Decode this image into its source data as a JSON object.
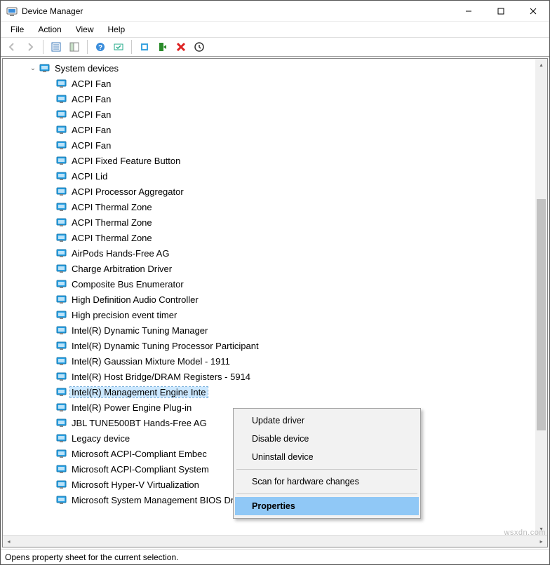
{
  "window": {
    "title": "Device Manager"
  },
  "menus": {
    "file": "File",
    "action": "Action",
    "view": "View",
    "help": "Help"
  },
  "tree": {
    "root": {
      "label": "System devices",
      "expanded": true
    },
    "items": [
      {
        "label": "ACPI Fan"
      },
      {
        "label": "ACPI Fan"
      },
      {
        "label": "ACPI Fan"
      },
      {
        "label": "ACPI Fan"
      },
      {
        "label": "ACPI Fan"
      },
      {
        "label": "ACPI Fixed Feature Button"
      },
      {
        "label": "ACPI Lid"
      },
      {
        "label": "ACPI Processor Aggregator"
      },
      {
        "label": "ACPI Thermal Zone"
      },
      {
        "label": "ACPI Thermal Zone"
      },
      {
        "label": "ACPI Thermal Zone"
      },
      {
        "label": "AirPods Hands-Free AG"
      },
      {
        "label": "Charge Arbitration Driver"
      },
      {
        "label": "Composite Bus Enumerator"
      },
      {
        "label": "High Definition Audio Controller"
      },
      {
        "label": "High precision event timer"
      },
      {
        "label": "Intel(R) Dynamic Tuning Manager"
      },
      {
        "label": "Intel(R) Dynamic Tuning Processor Participant"
      },
      {
        "label": "Intel(R) Gaussian Mixture Model - 1911"
      },
      {
        "label": "Intel(R) Host Bridge/DRAM Registers - 5914"
      },
      {
        "label": "Intel(R) Management Engine Interface",
        "selected": true,
        "truncated": "Intel(R) Management Engine Inte"
      },
      {
        "label": "Intel(R) Power Engine Plug-in"
      },
      {
        "label": "JBL TUNE500BT Hands-Free AG"
      },
      {
        "label": "Legacy device"
      },
      {
        "label": "Microsoft ACPI-Compliant Embedded Controller",
        "truncated": "Microsoft ACPI-Compliant Embec"
      },
      {
        "label": "Microsoft ACPI-Compliant System",
        "truncated": "Microsoft ACPI-Compliant System"
      },
      {
        "label": "Microsoft Hyper-V Virtualization",
        "truncated": "Microsoft Hyper-V Virtualization"
      },
      {
        "label": "Microsoft System Management BIOS Driver",
        "truncated": "Microsoft System Management BIOS Driver"
      }
    ]
  },
  "context_menu": {
    "update": "Update driver",
    "disable": "Disable device",
    "uninstall": "Uninstall device",
    "scan": "Scan for hardware changes",
    "properties": "Properties"
  },
  "statusbar": {
    "text": "Opens property sheet for the current selection."
  },
  "watermark": "wsxdn.com"
}
